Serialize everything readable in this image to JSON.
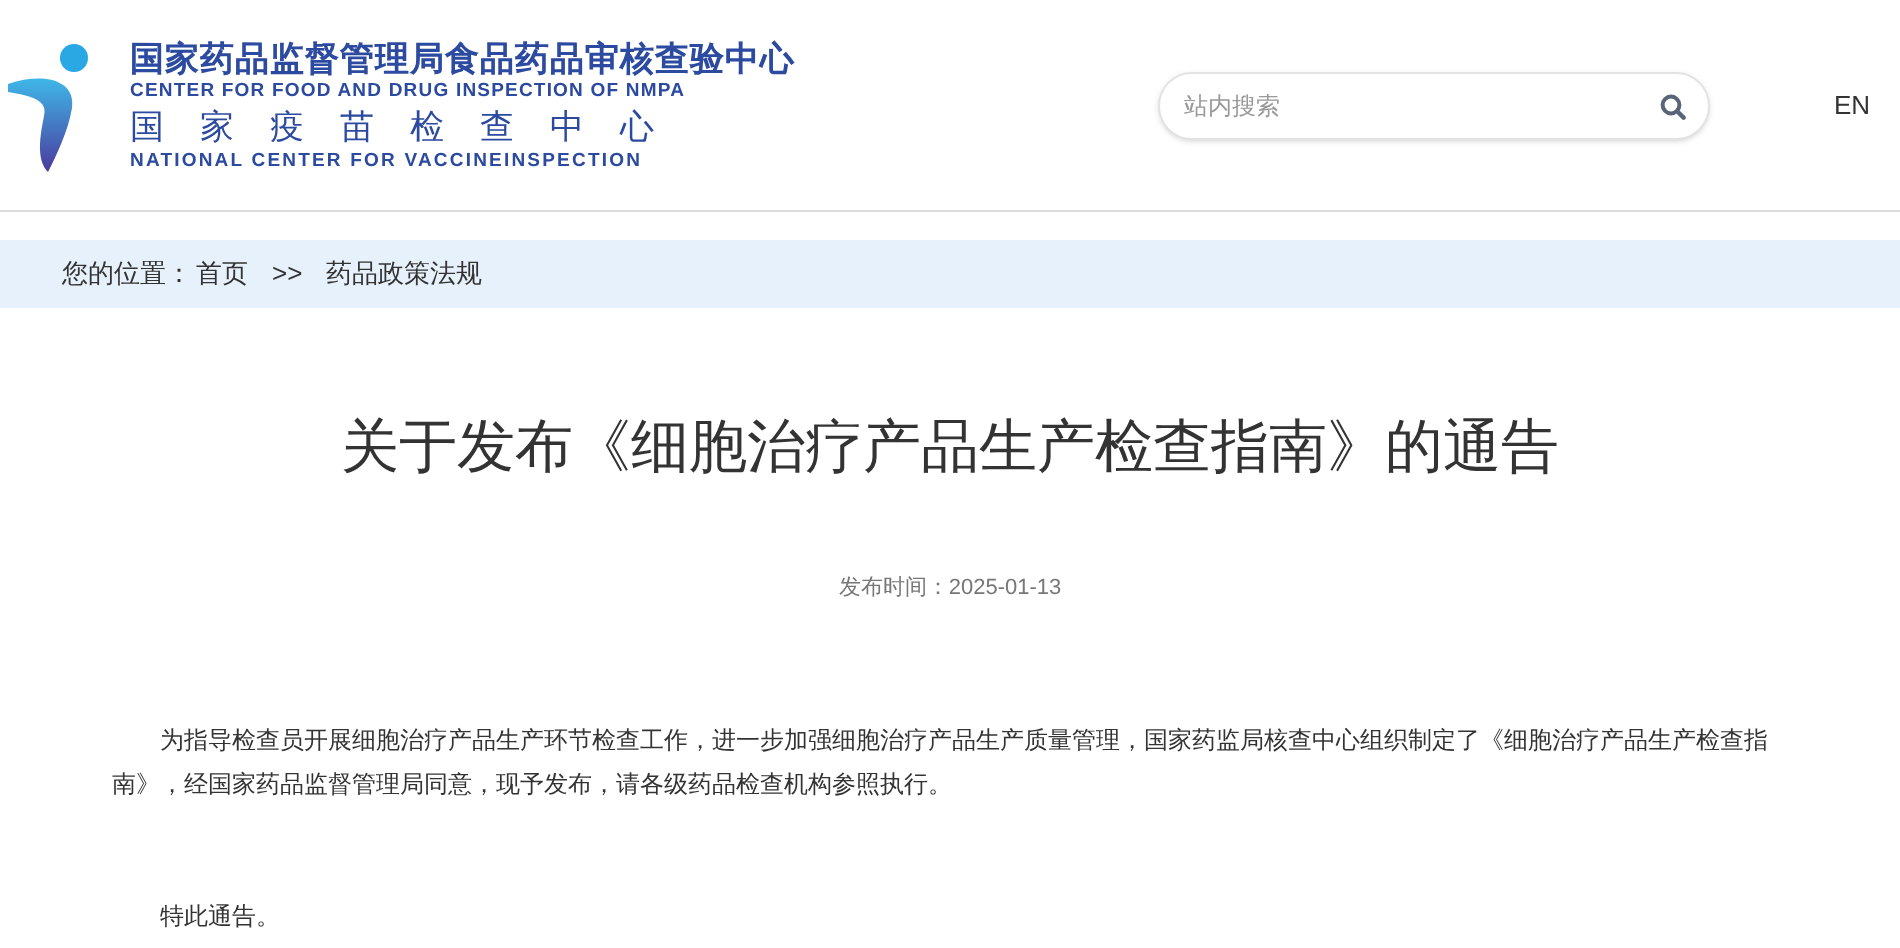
{
  "header": {
    "logo": {
      "name_cn": "国家药品监督管理局食品药品审核查验中心",
      "name_en": "CENTER FOR FOOD AND DRUG INSPECTION OF NMPA",
      "sub_cn": "国家疫苗检查中心",
      "sub_en": "NATIONAL CENTER FOR VACCINEINSPECTION"
    },
    "search": {
      "placeholder": "站内搜索"
    },
    "language": "EN"
  },
  "breadcrumb": {
    "label": "您的位置：",
    "items": [
      "首页",
      "药品政策法规"
    ],
    "separator": ">>"
  },
  "article": {
    "title": "关于发布《细胞治疗产品生产检查指南》的通告",
    "date": "发布时间：2025-01-13",
    "paragraphs": [
      "为指导检查员开展细胞治疗产品生产环节检查工作，进一步加强细胞治疗产品生产质量管理，国家药监局核查中心组织制定了《细胞治疗产品生产检查指南》，经国家药品监督管理局同意，现予发布，请各级药品检查机构参照执行。",
      "特此通告。"
    ]
  }
}
